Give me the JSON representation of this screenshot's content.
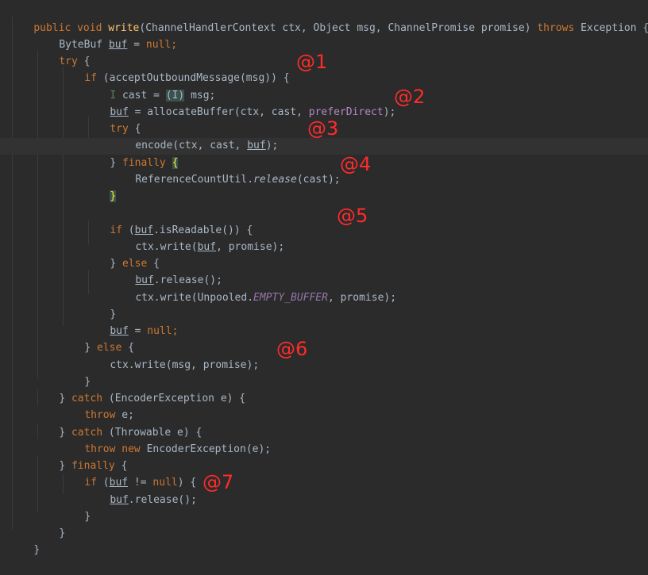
{
  "code": {
    "l1": {
      "public": "public",
      "void": "void",
      "method": "write",
      "params": "(ChannelHandlerContext ctx, Object msg, ChannelPromise promise)",
      "throws": "throws",
      "exception": "Exception {"
    },
    "l2": {
      "type": "ByteBuf ",
      "var": "buf",
      "eq": " = ",
      "null": "null",
      "semi": ";"
    },
    "l3": {
      "try": "try",
      "rest": " {"
    },
    "l4": {
      "if": "if",
      "rest": " (acceptOutboundMessage(msg)) {"
    },
    "l5": {
      "hint": "I",
      "mid": " cast = ",
      "cast": "(I)",
      "rest": " msg;"
    },
    "l6": {
      "var": "buf",
      "mid": " = allocateBuffer(ctx, cast, ",
      "param": "preferDirect",
      "end": ");"
    },
    "l7": {
      "try": "try",
      "rest": " {"
    },
    "l8": {
      "pre": "encode(ctx, cast, ",
      "var": "buf",
      "end": ");"
    },
    "l9": {
      "brace": "}",
      "finally": " finally ",
      "open": "{"
    },
    "l10": {
      "cls": "ReferenceCountUtil.",
      "method": "release",
      "end": "(cast);"
    },
    "l11": {
      "close": "}"
    },
    "l12": {
      "if": "if",
      "pre": " (",
      "var": "buf",
      "end": ".isReadable()) {"
    },
    "l13": {
      "pre": "ctx.write(",
      "var": "buf",
      "end": ", promise);"
    },
    "l14": {
      "brace": "} ",
      "else": "else",
      "end": " {"
    },
    "l15": {
      "var": "buf",
      "end": ".release();"
    },
    "l16": {
      "pre": "ctx.write(Unpooled.",
      "const": "EMPTY_BUFFER",
      "end": ", promise);"
    },
    "l17": {
      "close": "}"
    },
    "l18": {
      "var": "buf",
      "eq": " = ",
      "null": "null",
      "semi": ";"
    },
    "l19": {
      "brace": "} ",
      "else": "else",
      "end": " {"
    },
    "l20": {
      "text": "ctx.write(msg, promise);"
    },
    "l21": {
      "close": "}"
    },
    "l22": {
      "brace": "} ",
      "catch": "catch",
      "end": " (EncoderException e) {"
    },
    "l23": {
      "throw": "throw",
      "end": " e;"
    },
    "l24": {
      "brace": "} ",
      "catch": "catch",
      "end": " (Throwable e) {"
    },
    "l25": {
      "throw": "throw",
      "new": " new",
      "end": " EncoderException(e);"
    },
    "l26": {
      "brace": "} ",
      "finally": "finally",
      "end": " {"
    },
    "l27": {
      "if": "if",
      "pre": " (",
      "var": "buf",
      "neq": " != ",
      "null": "null",
      "end": ") {"
    },
    "l28": {
      "var": "buf",
      "end": ".release();"
    },
    "l29": {
      "close": "}"
    },
    "l30": {
      "close": "}"
    },
    "l31": {
      "close": "}"
    }
  },
  "annotations": [
    "@1",
    "@2",
    "@3",
    "@4",
    "@5",
    "@6",
    "@7"
  ],
  "colors": {
    "background": "#2b2b2b",
    "keyword": "#cc7832",
    "method_name": "#ffc66d",
    "text": "#a9b7c6",
    "annotation": "#ff2b2b"
  }
}
